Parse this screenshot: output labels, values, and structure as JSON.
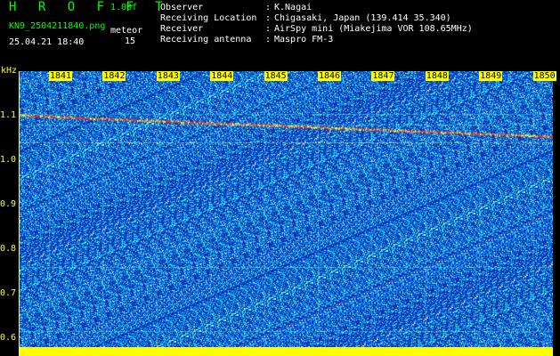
{
  "header": {
    "brand": "H R O F F T",
    "version": "1.00f",
    "filename": "KN9_2504211840.png",
    "datetime": "25.04.21 18:40",
    "mode_label": "meteor",
    "mode_value": "15"
  },
  "metadata": [
    {
      "label": "Observer",
      "value": "K.Nagai"
    },
    {
      "label": "Receiving Location",
      "value": "Chigasaki, Japan (139.414 35.340)"
    },
    {
      "label": "Receiver",
      "value": "AirSpy mini (Miakejima VOR 108.65MHz)"
    },
    {
      "label": "Receiving antenna",
      "value": "Maspro FM-3"
    }
  ],
  "axis": {
    "unit": "kHz",
    "x_ticks": [
      "1841",
      "1842",
      "1843",
      "1844",
      "1845",
      "1846",
      "1847",
      "1848",
      "1849",
      "1850"
    ],
    "y_ticks": [
      "1.1",
      "1.0",
      "0.9",
      "0.8",
      "0.7",
      "0.6"
    ],
    "y_range": [
      0.58,
      1.2
    ]
  },
  "colors": {
    "background": "#000000",
    "label_green": "#00ff00",
    "label_yellow": "#ffff00",
    "noise_blue": "#1030c0",
    "noise_cyan": "#00ffff",
    "trace_red": "#ff3020"
  }
}
